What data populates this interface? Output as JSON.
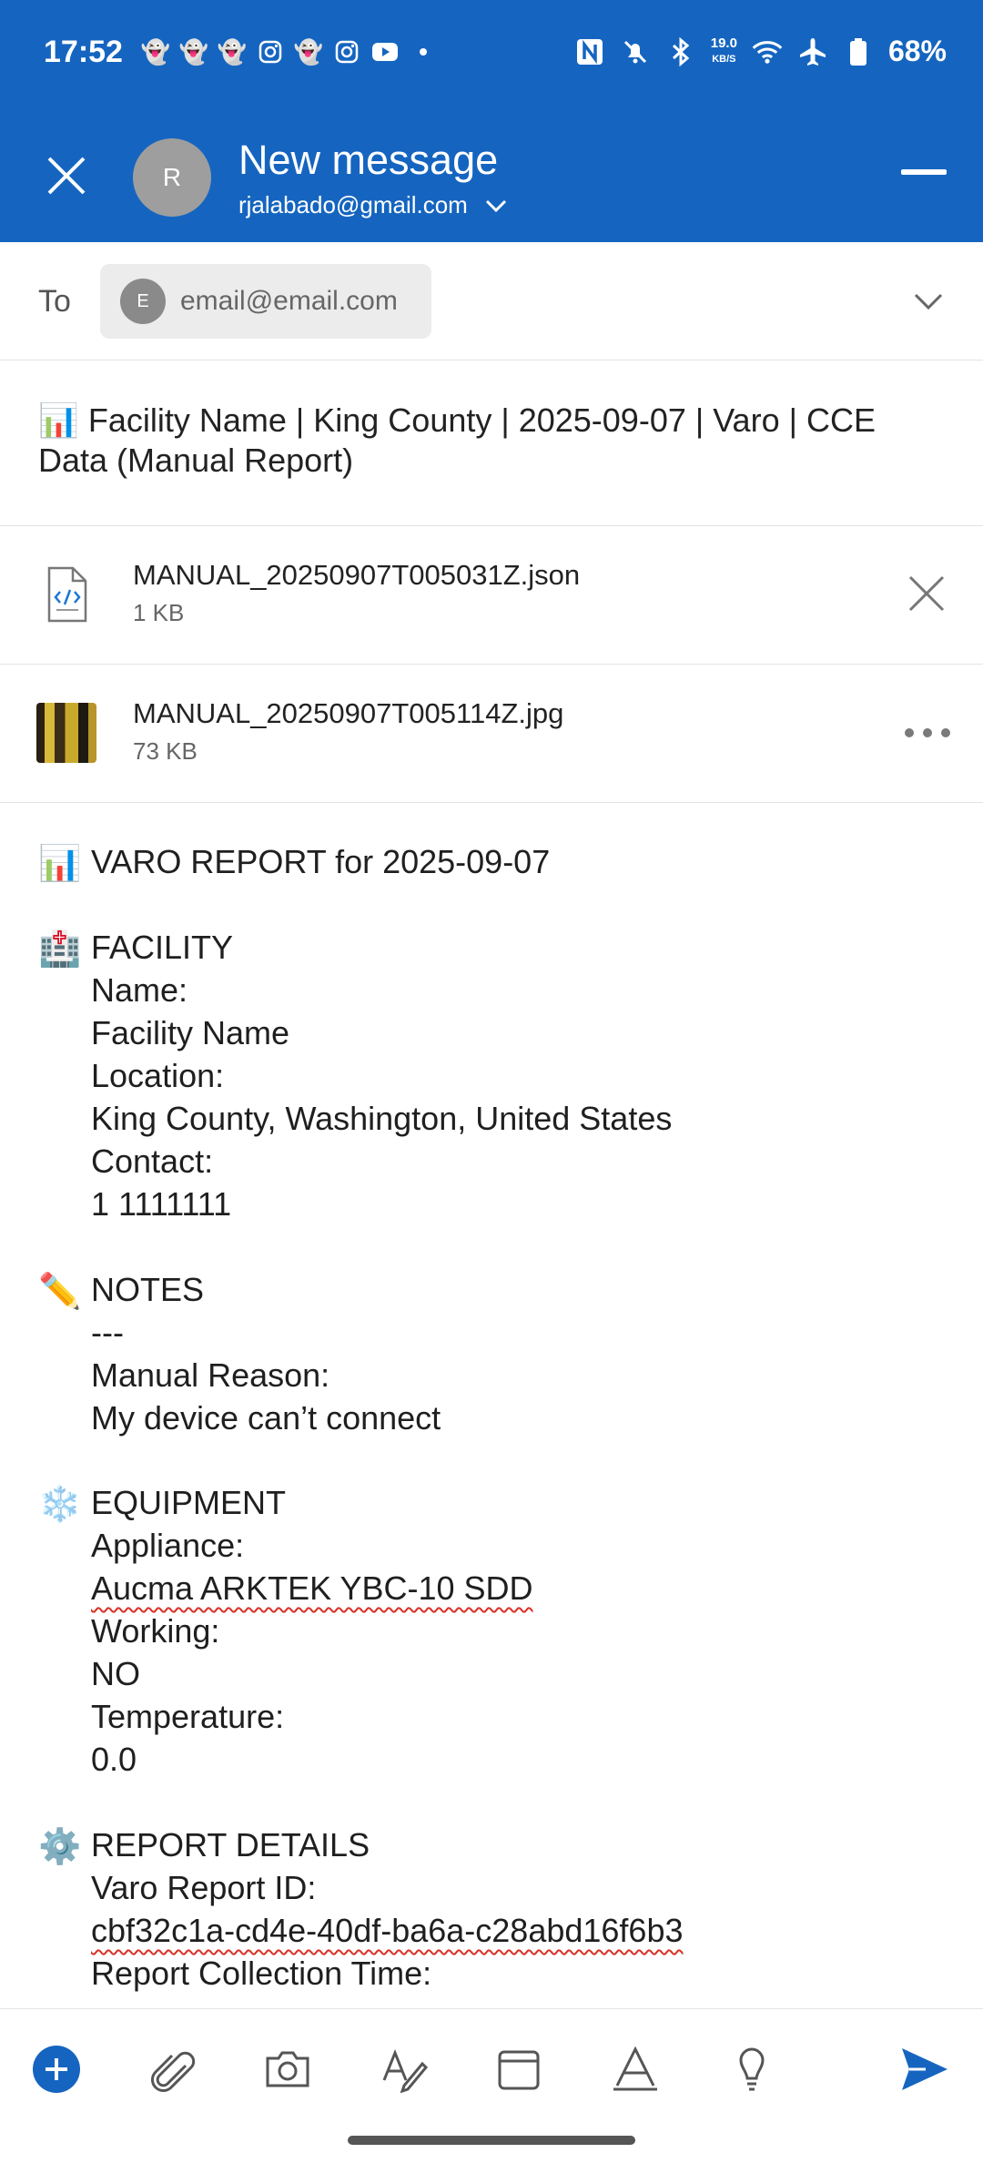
{
  "status_bar": {
    "time": "17:52",
    "network_speed_value": "19.0",
    "network_speed_unit": "KB/S",
    "battery": "68%"
  },
  "header": {
    "title": "New message",
    "avatar_initial": "R",
    "from_account": "rjalabado@gmail.com",
    "accent_color": "#1565c0"
  },
  "recipients": {
    "label": "To",
    "chip_initial": "E",
    "chip_email": "email@email.com"
  },
  "subject": {
    "icon": "bar-chart-emoji",
    "text": "Facility Name | King County | 2025-09-07 | Varo | CCE Data (Manual Report)"
  },
  "attachments": [
    {
      "name": "MANUAL_20250907T005031Z.json",
      "size": "1 KB",
      "icon": "code-file-icon",
      "action": "remove"
    },
    {
      "name": "MANUAL_20250907T005114Z.jpg",
      "size": "73 KB",
      "icon": "image-thumbnail",
      "action": "more"
    }
  ],
  "body": {
    "title": "VARO REPORT for 2025-09-07",
    "facility": {
      "heading": "FACILITY",
      "name_label": "Name:",
      "name_value": "Facility Name",
      "location_label": "Location:",
      "location_value": "King County, Washington, United States",
      "contact_label": "Contact:",
      "contact_value": "1 1111111"
    },
    "notes": {
      "heading": "NOTES",
      "divider": "---",
      "reason_label": "Manual Reason:",
      "reason_value": "My device can’t connect"
    },
    "equipment": {
      "heading": "EQUIPMENT",
      "appliance_label": "Appliance:",
      "appliance_value": "Aucma ARKTEK YBC-10 SDD",
      "working_label": "Working:",
      "working_value": "NO",
      "temperature_label": "Temperature:",
      "temperature_value": "0.0"
    },
    "report_details": {
      "heading": "REPORT DETAILS",
      "id_label": "Varo Report ID:",
      "id_value": "cbf32c1a-cd4e-40df-ba6a-c28abd16f6b3",
      "collection_label": "Report Collection Time:"
    }
  },
  "toolbar": {
    "items": [
      "add",
      "attach",
      "camera",
      "format-text",
      "template",
      "font",
      "ideas",
      "send"
    ]
  }
}
